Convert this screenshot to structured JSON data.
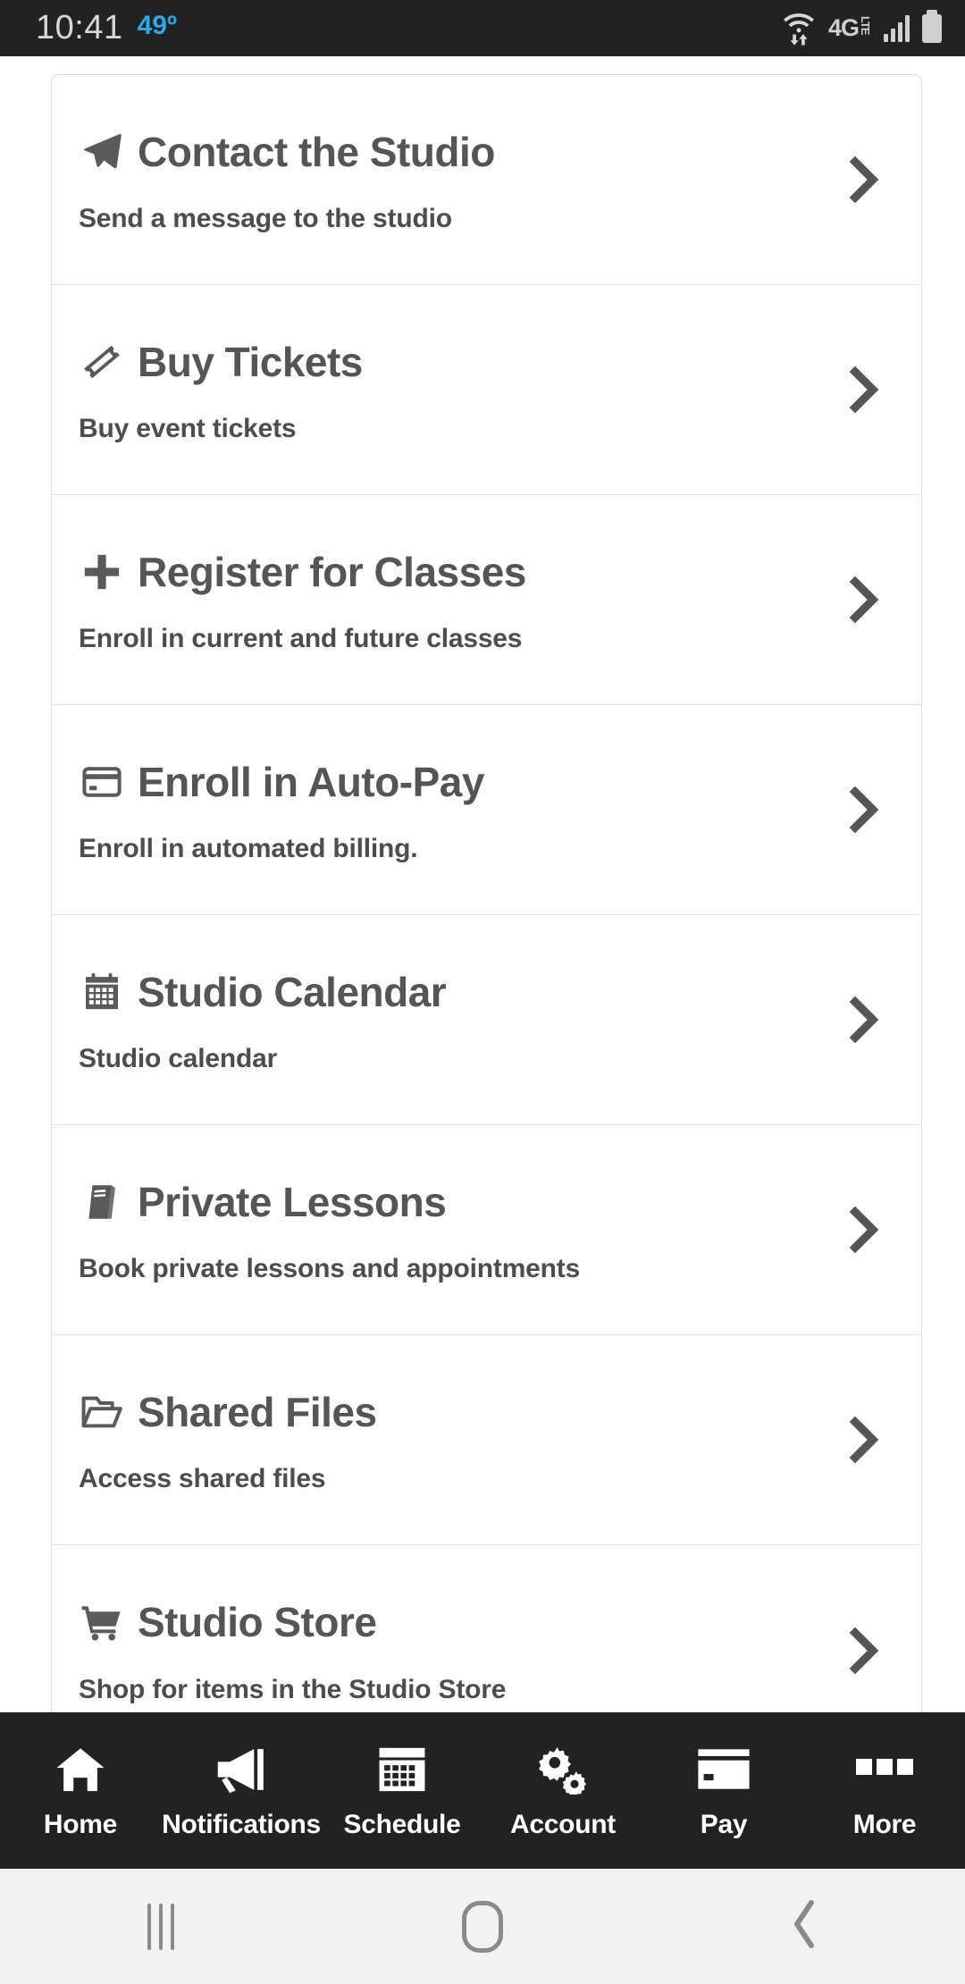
{
  "status_bar": {
    "time": "10:41",
    "temperature": "49º",
    "network_label": "4G",
    "network_sub": "LTE",
    "icons": [
      "wifi-transfer-icon",
      "4g-lte-icon",
      "signal-bars-icon",
      "battery-icon"
    ]
  },
  "menu": {
    "items": [
      {
        "icon": "paper-plane-icon",
        "title": "Contact the Studio",
        "subtitle": "Send a message to the studio",
        "chevron": "chevron-right-icon"
      },
      {
        "icon": "ticket-icon",
        "title": "Buy Tickets",
        "subtitle": "Buy event tickets",
        "chevron": "chevron-right-icon"
      },
      {
        "icon": "plus-icon",
        "title": "Register for Classes",
        "subtitle": "Enroll in current and future classes",
        "chevron": "chevron-right-icon"
      },
      {
        "icon": "credit-card-icon",
        "title": "Enroll in Auto-Pay",
        "subtitle": "Enroll in automated billing.",
        "chevron": "chevron-right-icon"
      },
      {
        "icon": "calendar-icon",
        "title": "Studio Calendar",
        "subtitle": "Studio calendar",
        "chevron": "chevron-right-icon"
      },
      {
        "icon": "book-icon",
        "title": "Private Lessons",
        "subtitle": "Book private lessons and appointments",
        "chevron": "chevron-right-icon"
      },
      {
        "icon": "folder-open-icon",
        "title": "Shared Files",
        "subtitle": "Access shared files",
        "chevron": "chevron-right-icon"
      },
      {
        "icon": "shopping-cart-icon",
        "title": "Studio Store",
        "subtitle": "Shop for items in the Studio Store",
        "chevron": "chevron-right-icon"
      }
    ]
  },
  "tab_bar": {
    "tabs": [
      {
        "icon": "home-icon",
        "label": "Home"
      },
      {
        "icon": "megaphone-icon",
        "label": "Notifications"
      },
      {
        "icon": "calendar-icon",
        "label": "Schedule"
      },
      {
        "icon": "gears-icon",
        "label": "Account"
      },
      {
        "icon": "credit-card-icon",
        "label": "Pay"
      },
      {
        "icon": "more-squares-icon",
        "label": "More"
      }
    ]
  },
  "system_nav": {
    "buttons": [
      {
        "icon": "recents-icon"
      },
      {
        "icon": "home-square-icon"
      },
      {
        "icon": "back-chevron-icon"
      }
    ]
  },
  "colors": {
    "status_bar_bg": "#222222",
    "temperature": "#2fa8e8",
    "tab_bar_bg": "#222222",
    "card_border": "#dedede",
    "title_text": "#555555",
    "nav_bar_bg": "#f2f2f2"
  }
}
